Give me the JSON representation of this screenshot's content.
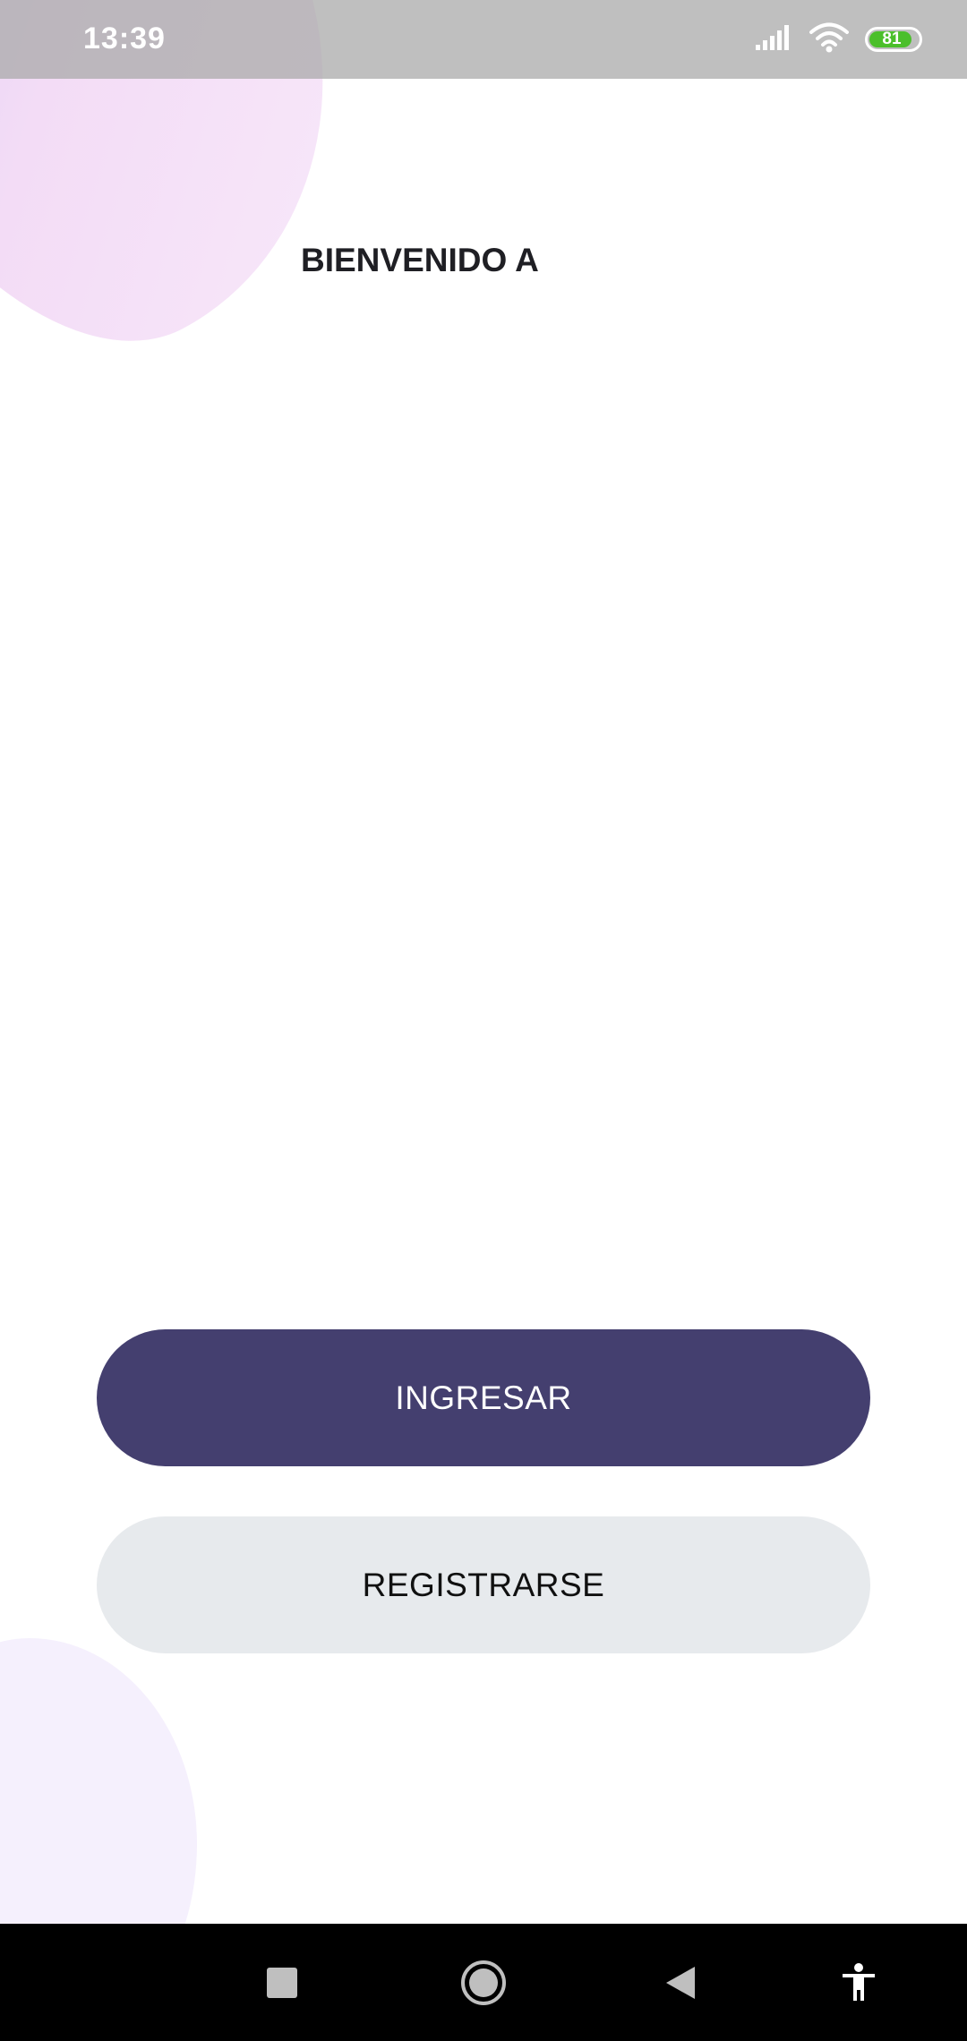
{
  "status_bar": {
    "time": "13:39",
    "battery_level": "81",
    "icons": [
      "signal-icon",
      "wifi-icon",
      "battery-icon"
    ]
  },
  "main": {
    "welcome_text": "BIENVENIDO A",
    "login_button": "INGRESAR",
    "register_button": "REGISTRARSE"
  },
  "nav_bar": {
    "buttons": [
      "recents-icon",
      "home-icon",
      "back-icon",
      "accessibility-icon"
    ]
  },
  "colors": {
    "primary_button": "#443f6f",
    "secondary_button": "#e7eaed",
    "battery_green": "#4bbf2b"
  }
}
